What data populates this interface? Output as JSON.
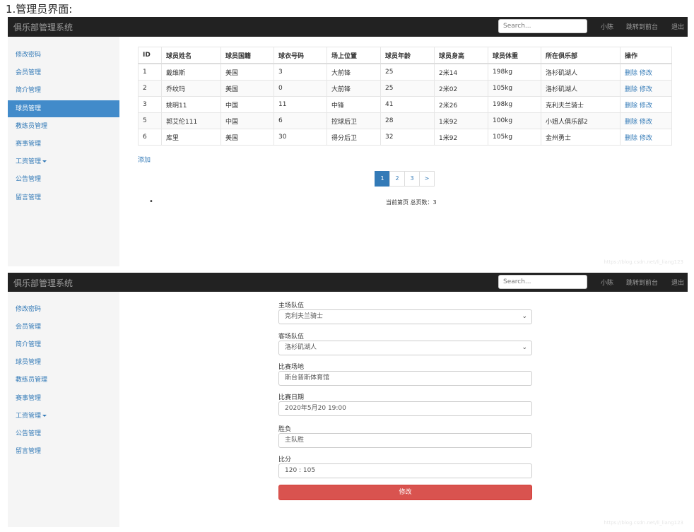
{
  "heading": "1.管理员界面:",
  "navbar": {
    "brand": "俱乐部管理系统",
    "search_placeholder": "Search...",
    "user": "小陈",
    "frontend_link": "跳转到前台",
    "logout": "退出"
  },
  "sidebar": {
    "items": [
      "修改密码",
      "会员管理",
      "简介管理",
      "球员管理",
      "教练员管理",
      "赛事管理",
      "工资管理",
      "公告管理",
      "留言管理"
    ],
    "active_item": "球员管理"
  },
  "players_table": {
    "headers": [
      "ID",
      "球员姓名",
      "球员国籍",
      "球衣号码",
      "场上位置",
      "球员年龄",
      "球员身高",
      "球员体重",
      "所在俱乐部",
      "操作"
    ],
    "rows": [
      {
        "id": "1",
        "name": "戴维斯",
        "nationality": "美国",
        "number": "3",
        "position": "大前锋",
        "age": "25",
        "height": "2米14",
        "weight": "198kg",
        "club": "洛杉矶湖人"
      },
      {
        "id": "2",
        "name": "乔纹玛",
        "nationality": "美国",
        "number": "0",
        "position": "大前锋",
        "age": "25",
        "height": "2米02",
        "weight": "105kg",
        "club": "洛杉矶湖人"
      },
      {
        "id": "3",
        "name": "姚明11",
        "nationality": "中国",
        "number": "11",
        "position": "中锋",
        "age": "41",
        "height": "2米26",
        "weight": "198kg",
        "club": "克利夫兰骑士"
      },
      {
        "id": "5",
        "name": "郭艾伦111",
        "nationality": "中国",
        "number": "6",
        "position": "控球后卫",
        "age": "28",
        "height": "1米92",
        "weight": "100kg",
        "club": "小姐人俱乐部2"
      },
      {
        "id": "6",
        "name": "库里",
        "nationality": "美国",
        "number": "30",
        "position": "得分后卫",
        "age": "32",
        "height": "1米92",
        "weight": "105kg",
        "club": "金州勇士"
      }
    ],
    "delete_label": "删除",
    "edit_label": "修改"
  },
  "add_link": "添加",
  "pagination": {
    "pages": [
      "1",
      "2",
      "3"
    ],
    "next": ">",
    "current": "1"
  },
  "page_info": "当前第页 总页数：3",
  "bullet": "•",
  "match_form": {
    "home_label": "主场队伍",
    "home_value": "克利夫兰骑士",
    "away_label": "客场队伍",
    "away_value": "洛杉矶湖人",
    "venue_label": "比赛场地",
    "venue_value": "斯台普斯体育馆",
    "date_label": "比赛日期",
    "date_value": "2020年5月20 19:00",
    "result_label": "胜负",
    "result_value": "主队胜",
    "score_label": "比分",
    "score_value": "120 : 105",
    "submit_label": "修改"
  },
  "watermark": "https://blog.csdn.net/li_liang123",
  "colors": {
    "navbar_bg": "#222222",
    "sidebar_bg": "#f5f5f5",
    "active_bg": "#428bca",
    "link": "#337ab7",
    "submit_bg": "#d9534f"
  }
}
